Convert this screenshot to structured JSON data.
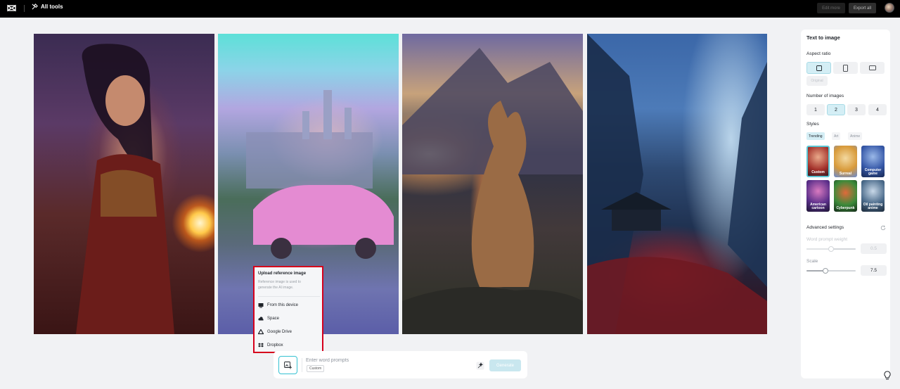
{
  "topbar": {
    "app_icon": "capcut-logo-icon",
    "all_tools_label": "All tools",
    "edit_more_label": "Edit more",
    "export_all_label": "Export all"
  },
  "gallery": [
    {
      "subject": "fantasy-warrior-woman"
    },
    {
      "subject": "pink-car-castle"
    },
    {
      "subject": "cat-mountain-sunset"
    },
    {
      "subject": "pagoda-valley"
    }
  ],
  "upload_popover": {
    "title": "Upload reference image",
    "description": "Reference image is used to generate the AI image.",
    "items": [
      {
        "label": "From this device",
        "icon": "device-icon"
      },
      {
        "label": "Space",
        "icon": "cloud-icon"
      },
      {
        "label": "Google Drive",
        "icon": "google-drive-icon"
      },
      {
        "label": "Dropbox",
        "icon": "dropbox-icon"
      }
    ],
    "highlight_color": "#d6001c"
  },
  "prompt_bar": {
    "placeholder": "Enter word prompts",
    "style_tag": "Custom",
    "generate_label": "Generate"
  },
  "panel": {
    "title": "Text to image",
    "aspect_ratio_label": "Aspect ratio",
    "aspect_ratios": [
      {
        "name": "square",
        "active": true
      },
      {
        "name": "portrait",
        "active": false
      },
      {
        "name": "landscape",
        "active": false
      }
    ],
    "original_label": "Original",
    "number_label": "Number of images",
    "numbers": [
      "1",
      "2",
      "3",
      "4"
    ],
    "selected_number": "2",
    "styles_label": "Styles",
    "style_tabs": [
      "Trending",
      "Art",
      "Anime"
    ],
    "active_style_tab": "Trending",
    "styles": [
      {
        "label": "Custom",
        "active": true
      },
      {
        "label": "Surreal",
        "active": false
      },
      {
        "label": "Computer game",
        "active": false
      },
      {
        "label": "American cartoon",
        "active": false
      },
      {
        "label": "Cyberpunk",
        "active": false
      },
      {
        "label": "Oil painting anime",
        "active": false
      }
    ],
    "advanced_label": "Advanced settings",
    "word_weight_label": "Word prompt weight",
    "word_weight_value": "0.5",
    "scale_label": "Scale",
    "scale_value": "7.5",
    "scale_fill_fraction": 0.38
  },
  "accent_color": "#34c1d2"
}
